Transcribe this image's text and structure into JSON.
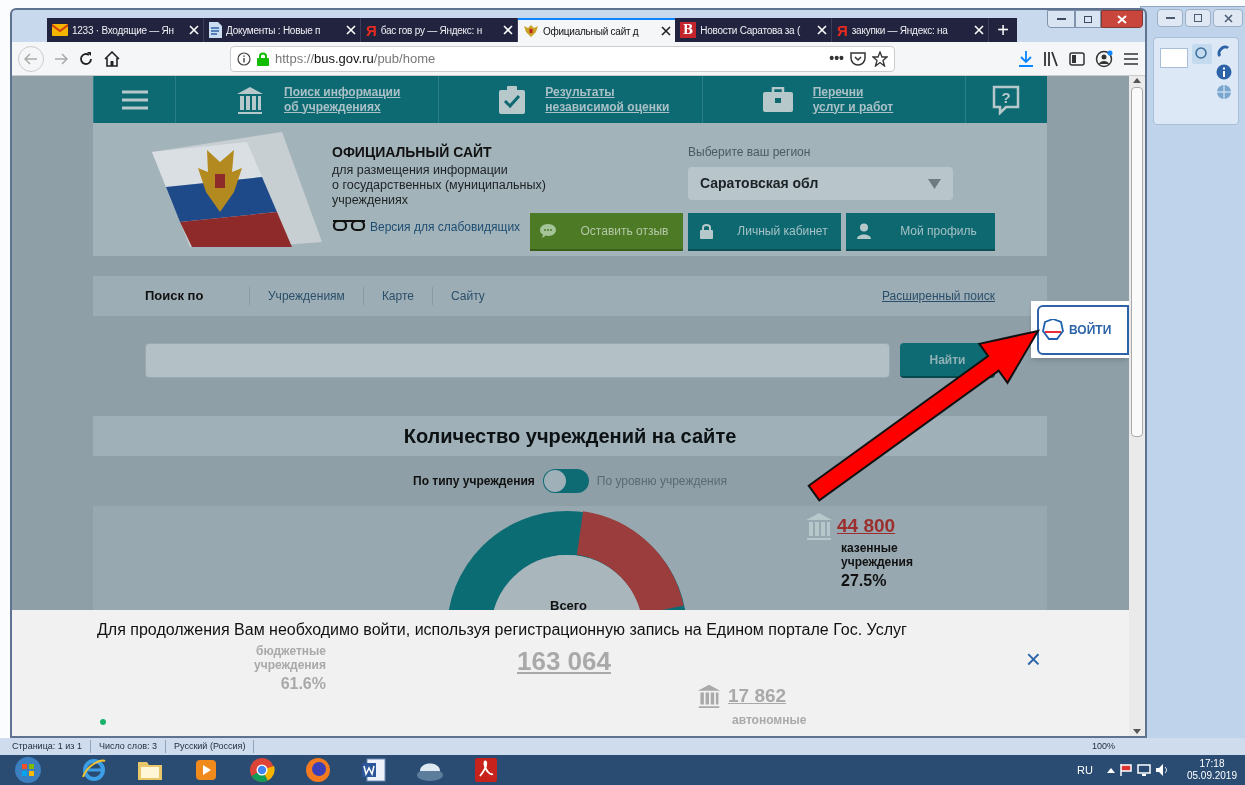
{
  "browser": {
    "tabs": [
      {
        "title": "1233 · Входящие — Ян",
        "favicon": {
          "kind": "mail"
        },
        "selected": false
      },
      {
        "title": "Документы : Новые п",
        "favicon": {
          "kind": "doc"
        },
        "selected": false
      },
      {
        "title": "бас гов ру — Яндекс: н",
        "favicon": {
          "kind": "letter",
          "text": "Я"
        },
        "selected": false
      },
      {
        "title": "Официальный сайт д",
        "favicon": {
          "kind": "emblem"
        },
        "selected": true
      },
      {
        "title": "Новости Саратова за (",
        "favicon": {
          "kind": "badge",
          "text": "B"
        },
        "selected": false
      },
      {
        "title": "закупки — Яндекс: на",
        "favicon": {
          "kind": "letter",
          "text": "Я"
        },
        "selected": false
      }
    ],
    "new_tab": "+",
    "url": {
      "scheme": "https://",
      "host": "bus.gov.ru",
      "path": "/pub/home"
    },
    "page_actions": "•••"
  },
  "site": {
    "nav": [
      {
        "kind": "menu"
      },
      {
        "kind": "building",
        "lines": [
          "Поиск информации",
          "об учреждениях"
        ]
      },
      {
        "kind": "check",
        "lines": [
          "Результаты",
          "независимой оценки"
        ]
      },
      {
        "kind": "case",
        "lines": [
          "Перечни",
          "услуг и работ"
        ]
      },
      {
        "kind": "help",
        "text": "?"
      }
    ],
    "header": {
      "title": "ОФИЦИАЛЬНЫЙ САЙТ",
      "subtitle_lines": [
        "для размещения информации",
        "о государственных (муниципальных)",
        "учреждениях"
      ],
      "low_vision_link": "Версия для слабовидящих",
      "region_label": "Выберите ваш регион",
      "region_value": "Саратовская обл",
      "buttons": [
        {
          "label": "Оставить отзыв",
          "kind": "feedback"
        },
        {
          "label": "Личный кабинет",
          "kind": "cabinet"
        },
        {
          "label": "Мой профиль",
          "kind": "profile"
        }
      ]
    },
    "search": {
      "label": "Поиск по",
      "tabs": [
        "Учреждениям",
        "Карте",
        "Сайту"
      ],
      "advanced_link": "Расширенный поиск",
      "button": "Найти"
    },
    "stats": {
      "title": "Количество учреждений на сайте",
      "toggle": [
        {
          "label": "По типу учреждения",
          "selected": true
        },
        {
          "label": "По уровню учреждения",
          "selected": false
        }
      ],
      "state_owned": {
        "value": "44 800",
        "label_lines": [
          "казенные",
          "учреждения"
        ],
        "percent": "27.5%"
      },
      "total_label": "Всего",
      "total_value": "163 064",
      "budget": {
        "label_lines": [
          "бюджетные",
          "учреждения"
        ],
        "percent": "61.6%"
      },
      "autonomous": {
        "value": "17 862",
        "label": "автономные"
      }
    },
    "login_popup": {
      "button": "ВОЙТИ"
    },
    "banner": {
      "message": "Для продолжения Вам необходимо войти, используя регистрационную запись на Едином портале Гос. Услуг",
      "close": "×"
    }
  },
  "word_status_bar": {
    "items": [
      "Страница: 1 из 1",
      "Число слов: 3",
      "Русский (Россия)"
    ],
    "zoom": "100%"
  },
  "taskbar": {
    "apps": [
      {
        "kind": "ie"
      },
      {
        "kind": "folder"
      },
      {
        "kind": "media"
      },
      {
        "kind": "chrome"
      },
      {
        "kind": "firefox"
      },
      {
        "kind": "word"
      },
      {
        "kind": "disk"
      },
      {
        "kind": "pdf"
      }
    ],
    "language": "RU",
    "time": "17:18",
    "date": "05.09.2019"
  }
}
